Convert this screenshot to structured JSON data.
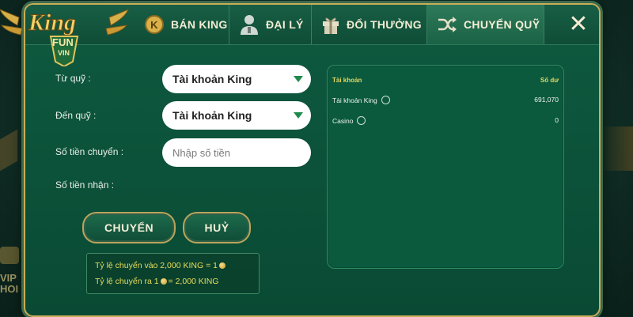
{
  "background": {
    "vip_text": "VIP\nHOI T"
  },
  "logo": {
    "line1": "King",
    "line2": "FUN",
    "line3": "VIN"
  },
  "tabs": [
    {
      "label": "BÁN KING",
      "icon": "king-coin-icon"
    },
    {
      "label": "ĐẠI LÝ",
      "icon": "agent-person-icon"
    },
    {
      "label": "ĐỔI THƯỞNG",
      "icon": "gift-icon"
    },
    {
      "label": "CHUYỂN QUỸ",
      "icon": "shuffle-transfer-icon"
    }
  ],
  "form": {
    "from_label": "Từ quỹ :",
    "to_label": "Đến quỹ :",
    "amount_label": "Số tiền chuyển :",
    "receive_label": "Số tiền nhận :",
    "from_value": "Tài khoản King",
    "to_value": "Tài khoản King",
    "amount_placeholder": "Nhập số tiền"
  },
  "buttons": {
    "transfer": "CHUYỂN",
    "cancel": "HUỶ"
  },
  "rates": {
    "in_text": "Tỷ lệ chuyển vào 2,000 KING = 1",
    "out_prefix": "Tỷ lệ chuyển ra 1",
    "out_suffix": "= 2,000 KING"
  },
  "accounts_table": {
    "header_account": "Tài khoản",
    "header_balance": "Số dư",
    "rows": [
      {
        "name": "Tài khoản King",
        "balance": "691,070"
      },
      {
        "name": "Casino",
        "balance": "0"
      }
    ]
  },
  "colors": {
    "gold": "#c9ae58",
    "panel_green": "#0e5a40",
    "rate_yellow": "#e7dd5c"
  }
}
